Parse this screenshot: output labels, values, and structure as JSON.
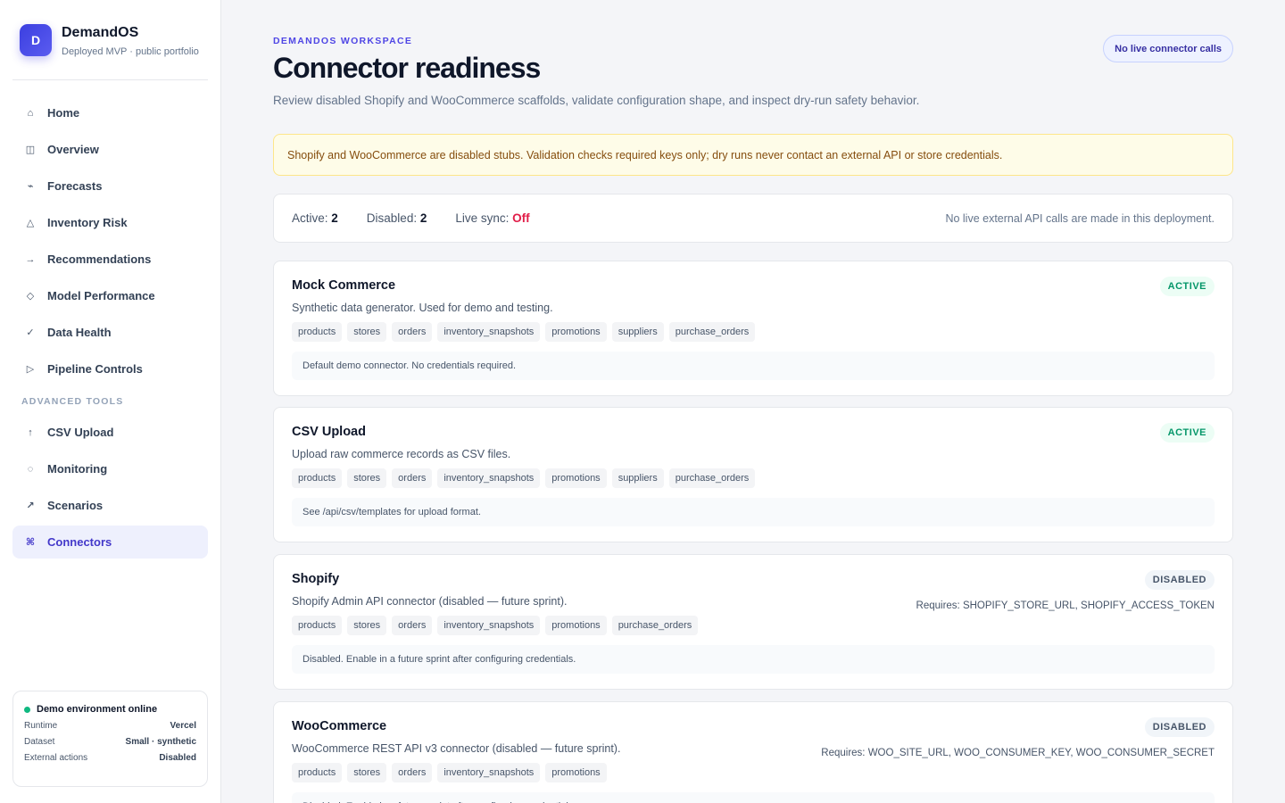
{
  "brand": {
    "logo_letter": "D",
    "name": "DemandOS",
    "subtitle": "Deployed MVP · public portfolio"
  },
  "nav": {
    "items": [
      {
        "label": "Home",
        "icon": "⌂"
      },
      {
        "label": "Overview",
        "icon": "◫"
      },
      {
        "label": "Forecasts",
        "icon": "⌁"
      },
      {
        "label": "Inventory Risk",
        "icon": "△"
      },
      {
        "label": "Recommendations",
        "icon": "→"
      },
      {
        "label": "Model Performance",
        "icon": "◇"
      },
      {
        "label": "Data Health",
        "icon": "✓"
      },
      {
        "label": "Pipeline Controls",
        "icon": "▷"
      }
    ],
    "section_label": "ADVANCED TOOLS",
    "advanced": [
      {
        "label": "CSV Upload",
        "icon": "↑"
      },
      {
        "label": "Monitoring",
        "icon": "◌"
      },
      {
        "label": "Scenarios",
        "icon": "↗"
      },
      {
        "label": "Connectors",
        "icon": "⌘",
        "active": true
      }
    ]
  },
  "environment": {
    "title": "Demo environment online",
    "rows": [
      {
        "label": "Runtime",
        "value": "Vercel"
      },
      {
        "label": "Dataset",
        "value": "Small · synthetic"
      },
      {
        "label": "External actions",
        "value": "Disabled"
      }
    ]
  },
  "header": {
    "eyebrow": "DEMANDOS WORKSPACE",
    "title": "Connector readiness",
    "description": "Review disabled Shopify and WooCommerce scaffolds, validate configuration shape, and inspect dry-run safety behavior.",
    "pill": "No live connector calls"
  },
  "warning": "Shopify and WooCommerce are disabled stubs. Validation checks required keys only; dry runs never contact an external API or store credentials.",
  "stats": {
    "active_label": "Active:",
    "active_value": "2",
    "disabled_label": "Disabled:",
    "disabled_value": "2",
    "sync_label": "Live sync:",
    "sync_value": "Off",
    "note": "No live external API calls are made in this deployment."
  },
  "connectors": [
    {
      "name": "Mock Commerce",
      "description": "Synthetic data generator. Used for demo and testing.",
      "status": "ACTIVE",
      "requires": "",
      "tags": [
        "products",
        "stores",
        "orders",
        "inventory_snapshots",
        "promotions",
        "suppliers",
        "purchase_orders"
      ],
      "note": "Default demo connector. No credentials required."
    },
    {
      "name": "CSV Upload",
      "description": "Upload raw commerce records as CSV files.",
      "status": "ACTIVE",
      "requires": "",
      "tags": [
        "products",
        "stores",
        "orders",
        "inventory_snapshots",
        "promotions",
        "suppliers",
        "purchase_orders"
      ],
      "note": "See /api/csv/templates for upload format."
    },
    {
      "name": "Shopify",
      "description": "Shopify Admin API connector (disabled — future sprint).",
      "status": "DISABLED",
      "requires": "Requires: SHOPIFY_STORE_URL, SHOPIFY_ACCESS_TOKEN",
      "tags": [
        "products",
        "stores",
        "orders",
        "inventory_snapshots",
        "promotions",
        "purchase_orders"
      ],
      "note": "Disabled. Enable in a future sprint after configuring credentials."
    },
    {
      "name": "WooCommerce",
      "description": "WooCommerce REST API v3 connector (disabled — future sprint).",
      "status": "DISABLED",
      "requires": "Requires: WOO_SITE_URL, WOO_CONSUMER_KEY, WOO_CONSUMER_SECRET",
      "tags": [
        "products",
        "stores",
        "orders",
        "inventory_snapshots",
        "promotions"
      ],
      "note": "Disabled. Enable in a future sprint after configuring credentials."
    }
  ]
}
